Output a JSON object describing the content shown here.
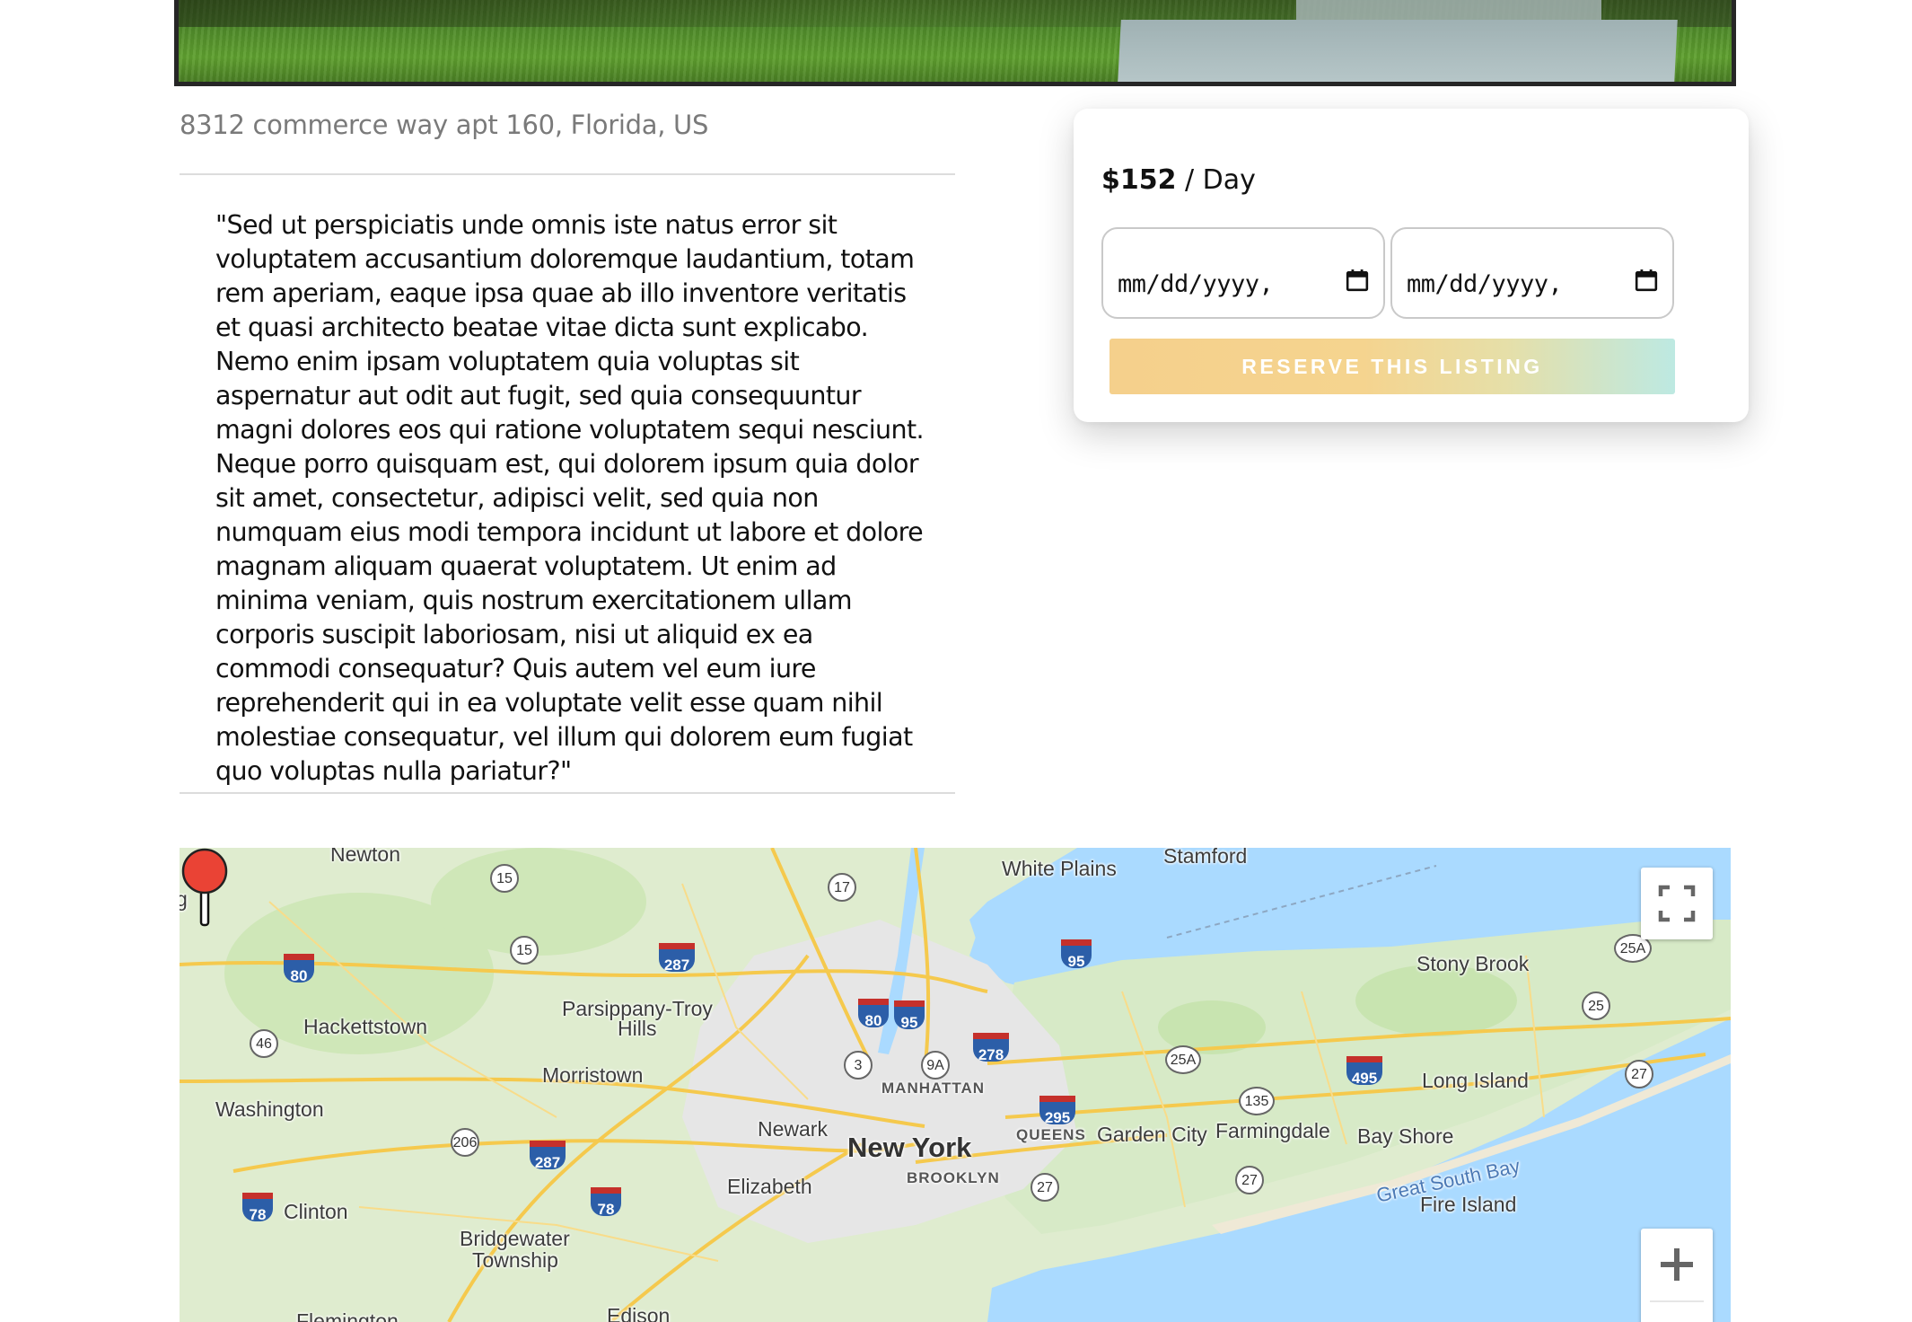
{
  "listing": {
    "address": "8312 commerce way apt 160, Florida, US",
    "description": "\"Sed ut perspiciatis unde omnis iste natus error sit voluptatem accusantium doloremque laudantium, totam rem aperiam, eaque ipsa quae ab illo inventore veritatis et quasi architecto beatae vitae dicta sunt explicabo. Nemo enim ipsam voluptatem quia voluptas sit aspernatur aut odit aut fugit, sed quia consequuntur magni dolores eos qui ratione voluptatem sequi nesciunt. Neque porro quisquam est, qui dolorem ipsum quia dolor sit amet, consectetur, adipisci velit, sed quia non numquam eius modi tempora incidunt ut labore et dolore magnam aliquam quaerat voluptatem. Ut enim ad minima veniam, quis nostrum exercitationem ullam corporis suscipit laboriosam, nisi ut aliquid ex ea commodi consequatur? Quis autem vel eum iure reprehenderit qui in ea voluptate velit esse quam nihil molestiae consequatur, vel illum qui dolorem eum fugiat quo voluptas nulla pariatur?\""
  },
  "booking": {
    "price": "$152",
    "per": " / Day",
    "start_date_placeholder": "mm/dd/yyyy,",
    "end_date_placeholder": "mm/dd/yyyy,",
    "reserve_label": "RESERVE THIS LISTING",
    "button_gradient": [
      "#f5d08c",
      "#bde9e2"
    ]
  },
  "map": {
    "places": {
      "newton": "Newton",
      "stamford": "Stamford",
      "white_plains": "White Plains",
      "stony_brook": "Stony Brook",
      "hackettstown": "Hackettstown",
      "parsippany": "Parsippany-Troy",
      "hills": "Hills",
      "morristown": "Morristown",
      "washington": "Washington",
      "manhattan": "MANHATTAN",
      "newark": "Newark",
      "new_york": "New York",
      "queens": "QUEENS",
      "garden_city": "Garden City",
      "farmingdale": "Farmingdale",
      "bay_shore": "Bay Shore",
      "long_island": "Long Island",
      "brooklyn": "BROOKLYN",
      "elizabeth": "Elizabeth",
      "clinton": "Clinton",
      "bridgewater": "Bridgewater",
      "township": "Township",
      "great_south_bay": "Great South Bay",
      "fire_island": "Fire Island",
      "flemington": "Flemington",
      "edison": "Edison",
      "g": "g"
    },
    "routes": {
      "r15a": "15",
      "r15b": "15",
      "r17": "17",
      "r46": "46",
      "r206": "206",
      "r3": "3",
      "r9a": "9A",
      "r25a": "25A",
      "r135": "135",
      "r27a": "27",
      "r27b": "27",
      "r25": "25",
      "r25a2": "25A",
      "r27c": "27",
      "i80a": "80",
      "i80b": "80",
      "i287a": "287",
      "i287b": "287",
      "i95a": "95",
      "i95b": "95",
      "i278": "278",
      "i295": "295",
      "i495": "495",
      "i78a": "78",
      "i78b": "78"
    },
    "colors": {
      "land": "#dfeccf",
      "water": "#aadaff",
      "road": "#f8d26b",
      "pin": "#ea4335"
    }
  }
}
